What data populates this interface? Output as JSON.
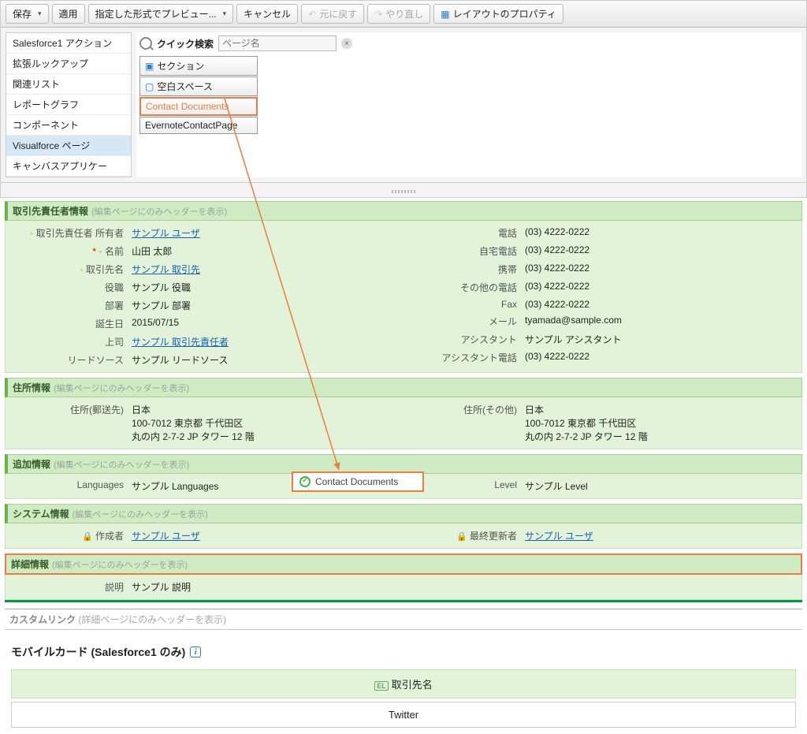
{
  "toolbar": {
    "save": "保存",
    "apply": "適用",
    "preview": "指定した形式でプレビュー...",
    "cancel": "キャンセル",
    "undo": "元に戻す",
    "redo": "やり直し",
    "layout_props": "レイアウトのプロパティ"
  },
  "palette": {
    "categories": [
      "Salesforce1 アクション",
      "拡張ルックアップ",
      "関連リスト",
      "レポートグラフ",
      "コンポーネント",
      "Visualforce ページ",
      "キャンバスアプリケー"
    ],
    "active_category_index": 5,
    "search_label": "クイック検索",
    "search_placeholder": "ページ名",
    "items": {
      "section": "セクション",
      "blank": "空白スペース",
      "contact_docs": "Contact Documents",
      "evernote": "EvernoteContactPage"
    }
  },
  "sections": {
    "contact_info": {
      "title": "取引先責任者情報",
      "hint": "(編集ページにのみヘッダーを表示)",
      "left": [
        {
          "label": "取引先責任者 所有者",
          "value": "サンプル ユーザ",
          "link": true,
          "ro": true
        },
        {
          "label": "名前",
          "value": "山田 太郎",
          "req": true,
          "ro": true
        },
        {
          "label": "取引先名",
          "value": "サンプル 取引先",
          "link": true,
          "ro": true
        },
        {
          "label": "役職",
          "value": "サンプル 役職"
        },
        {
          "label": "部署",
          "value": "サンプル 部署"
        },
        {
          "label": "誕生日",
          "value": "2015/07/15"
        },
        {
          "label": "上司",
          "value": "サンプル 取引先責任者",
          "link": true
        },
        {
          "label": "リードソース",
          "value": "サンプル リードソース"
        }
      ],
      "right": [
        {
          "label": "電話",
          "value": "(03) 4222-0222"
        },
        {
          "label": "自宅電話",
          "value": "(03) 4222-0222"
        },
        {
          "label": "携帯",
          "value": "(03) 4222-0222"
        },
        {
          "label": "その他の電話",
          "value": "(03) 4222-0222"
        },
        {
          "label": "Fax",
          "value": "(03) 4222-0222"
        },
        {
          "label": "メール",
          "value": "tyamada@sample.com"
        },
        {
          "label": "アシスタント",
          "value": "サンプル アシスタント"
        },
        {
          "label": "アシスタント電話",
          "value": "(03) 4222-0222"
        }
      ]
    },
    "address": {
      "title": "住所情報",
      "hint": "(編集ページにのみヘッダーを表示)",
      "left": [
        {
          "label": "住所(郵送先)",
          "value": "日本\n100-7012 東京都 千代田区\n丸の内 2-7-2 JP タワー 12 階"
        }
      ],
      "right": [
        {
          "label": "住所(その他)",
          "value": "日本\n100-7012 東京都 千代田区\n丸の内 2-7-2 JP タワー 12 階"
        }
      ]
    },
    "additional": {
      "title": "追加情報",
      "hint": "(編集ページにのみヘッダーを表示)",
      "left": [
        {
          "label": "Languages",
          "value": "サンプル Languages"
        }
      ],
      "right": [
        {
          "label": "Level",
          "value": "サンプル Level"
        }
      ]
    },
    "system": {
      "title": "システム情報",
      "hint": "(編集ページにのみヘッダーを表示)",
      "left": [
        {
          "label": "作成者",
          "value": "サンプル ユーザ",
          "link": true,
          "lock": true
        }
      ],
      "right": [
        {
          "label": "最終更新者",
          "value": "サンプル ユーザ",
          "link": true,
          "lock": true
        }
      ]
    },
    "detail": {
      "title": "詳細情報",
      "hint": "(編集ページにのみヘッダーを表示)",
      "left": [
        {
          "label": "説明",
          "value": "サンプル 説明"
        }
      ]
    }
  },
  "custom_links": {
    "title": "カスタムリンク",
    "hint": "(詳細ページにのみヘッダーを表示)"
  },
  "mobile": {
    "title": "モバイルカード (Salesforce1 のみ)",
    "cards": [
      "取引先名",
      "Twitter"
    ]
  },
  "drop": {
    "label": "Contact Documents"
  }
}
